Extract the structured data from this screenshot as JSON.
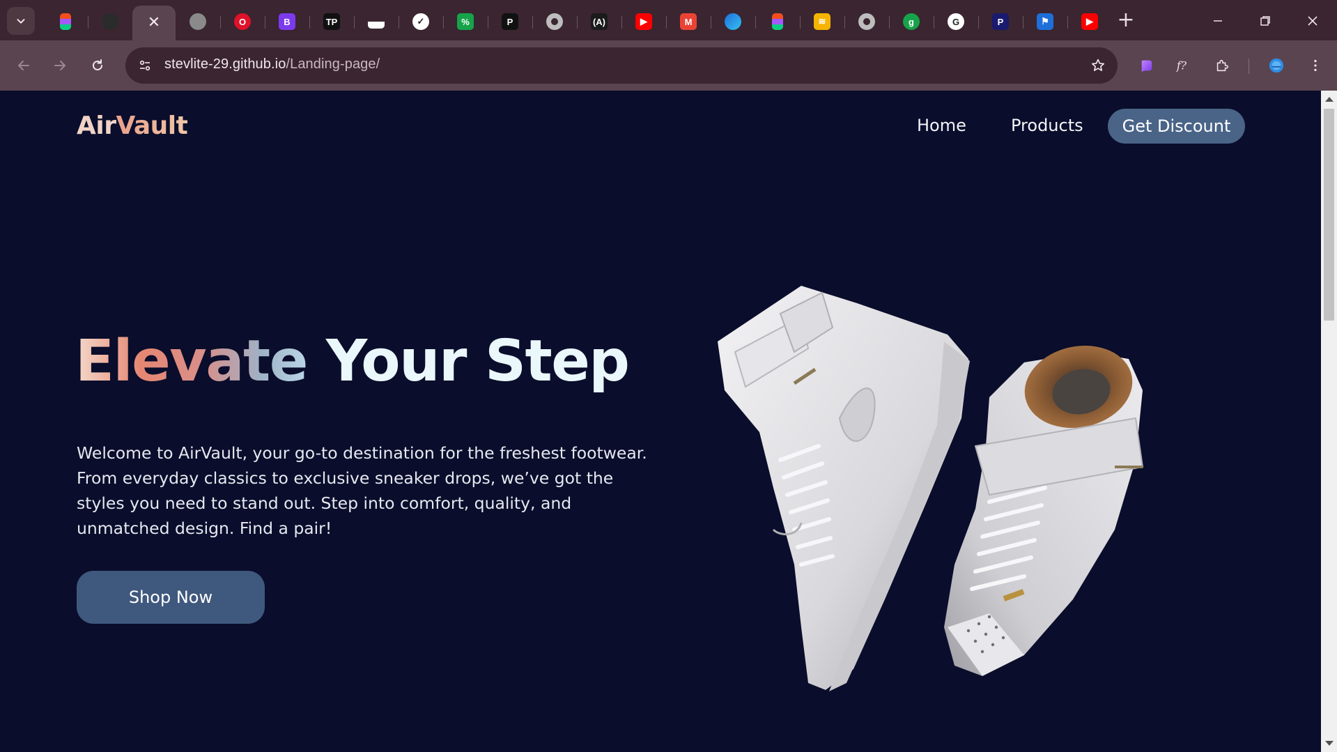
{
  "browser": {
    "tabs": [
      {
        "icon": "figma-icon",
        "color": "#f24e1e",
        "glyph": "",
        "active": false
      },
      {
        "icon": "github-icon",
        "color": "#2b2b2b",
        "glyph": "",
        "active": false
      },
      {
        "icon": "close-icon",
        "color": "",
        "glyph": "✕",
        "active": true
      },
      {
        "icon": "globe-icon",
        "color": "#8a8a8a",
        "glyph": "",
        "active": false
      },
      {
        "icon": "opera-icon",
        "color": "#e0112b",
        "glyph": "O",
        "active": false
      },
      {
        "icon": "bootstrap-icon",
        "color": "#7c3aed",
        "glyph": "B",
        "active": false
      },
      {
        "icon": "tp-icon",
        "color": "#111111",
        "glyph": "TP",
        "active": false
      },
      {
        "icon": "unsplash-icon",
        "color": "#111111",
        "glyph": "",
        "active": false
      },
      {
        "icon": "nike-icon",
        "color": "#ffffff",
        "glyph": "✓",
        "active": false
      },
      {
        "icon": "colorful-icon",
        "color": "#16a34a",
        "glyph": "%",
        "active": false
      },
      {
        "icon": "p-icon",
        "color": "#111111",
        "glyph": "P",
        "active": false
      },
      {
        "icon": "chromium-icon",
        "color": "#9a9a9a",
        "glyph": "",
        "active": false
      },
      {
        "icon": "code-icon",
        "color": "#1b1b1b",
        "glyph": "(A)",
        "active": false
      },
      {
        "icon": "youtube-icon",
        "color": "#ff0000",
        "glyph": "▶",
        "active": false
      },
      {
        "icon": "gmail-icon",
        "color": "#ea4335",
        "glyph": "M",
        "active": false
      },
      {
        "icon": "edge-icon",
        "color": "#1e6fd9",
        "glyph": "",
        "active": false
      },
      {
        "icon": "figma-icon",
        "color": "#f24e1e",
        "glyph": "",
        "active": false
      },
      {
        "icon": "layers-icon",
        "color": "#f5b400",
        "glyph": "≋",
        "active": false
      },
      {
        "icon": "chromium-icon",
        "color": "#9a9a9a",
        "glyph": "",
        "active": false
      },
      {
        "icon": "green-icon",
        "color": "#16a34a",
        "glyph": "g",
        "active": false
      },
      {
        "icon": "google-icon",
        "color": "#ffffff",
        "glyph": "G",
        "active": false
      },
      {
        "icon": "paypal-icon",
        "color": "#1a1a6e",
        "glyph": "P",
        "active": false
      },
      {
        "icon": "flag-icon",
        "color": "#1e6fd9",
        "glyph": "⚑",
        "active": false
      },
      {
        "icon": "youtube-icon",
        "color": "#ff0000",
        "glyph": "▶",
        "active": false
      }
    ],
    "url_host": "stevlite-29.github.io",
    "url_path": "/Landing-page/"
  },
  "page": {
    "logo_air": "Air",
    "logo_vault": "Vault",
    "nav": {
      "home": "Home",
      "products": "Products",
      "discount": "Get Discount"
    },
    "hero": {
      "title_gradient": "Elevate",
      "title_rest": " Your Step",
      "body": "Welcome to AirVault, your go-to destination for the freshest footwear. From everyday classics to exclusive sneaker drops, we’ve got the styles you need to stand out. Step into comfort, quality, and unmatched design. Find a pair!",
      "cta": "Shop Now"
    }
  },
  "colors": {
    "page_bg": "#0a0d2b",
    "accent_button": "#4a6488",
    "shop_button": "#3f587d",
    "browser_frame": "#3a2530",
    "toolbar": "#5a4450"
  }
}
